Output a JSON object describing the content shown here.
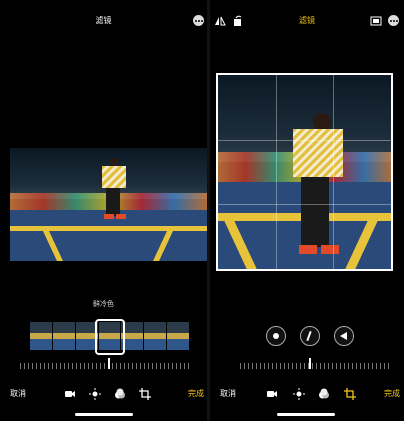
{
  "left": {
    "title": "滤镜",
    "filter_name": "鲜冷色",
    "cancel_label": "取消",
    "done_label": "完成"
  },
  "right": {
    "title": "滤镜",
    "cancel_label": "取消",
    "done_label": "完成"
  },
  "colors": {
    "accent": "#f5c518",
    "background": "#000000",
    "text": "#ffffff"
  },
  "icons": {
    "toolbar": [
      "video-camera-icon",
      "sun-adjust-icon",
      "filters-icon",
      "crop-icon"
    ],
    "top_right": [
      "aspect-ratio-icon",
      "more-icon"
    ]
  }
}
